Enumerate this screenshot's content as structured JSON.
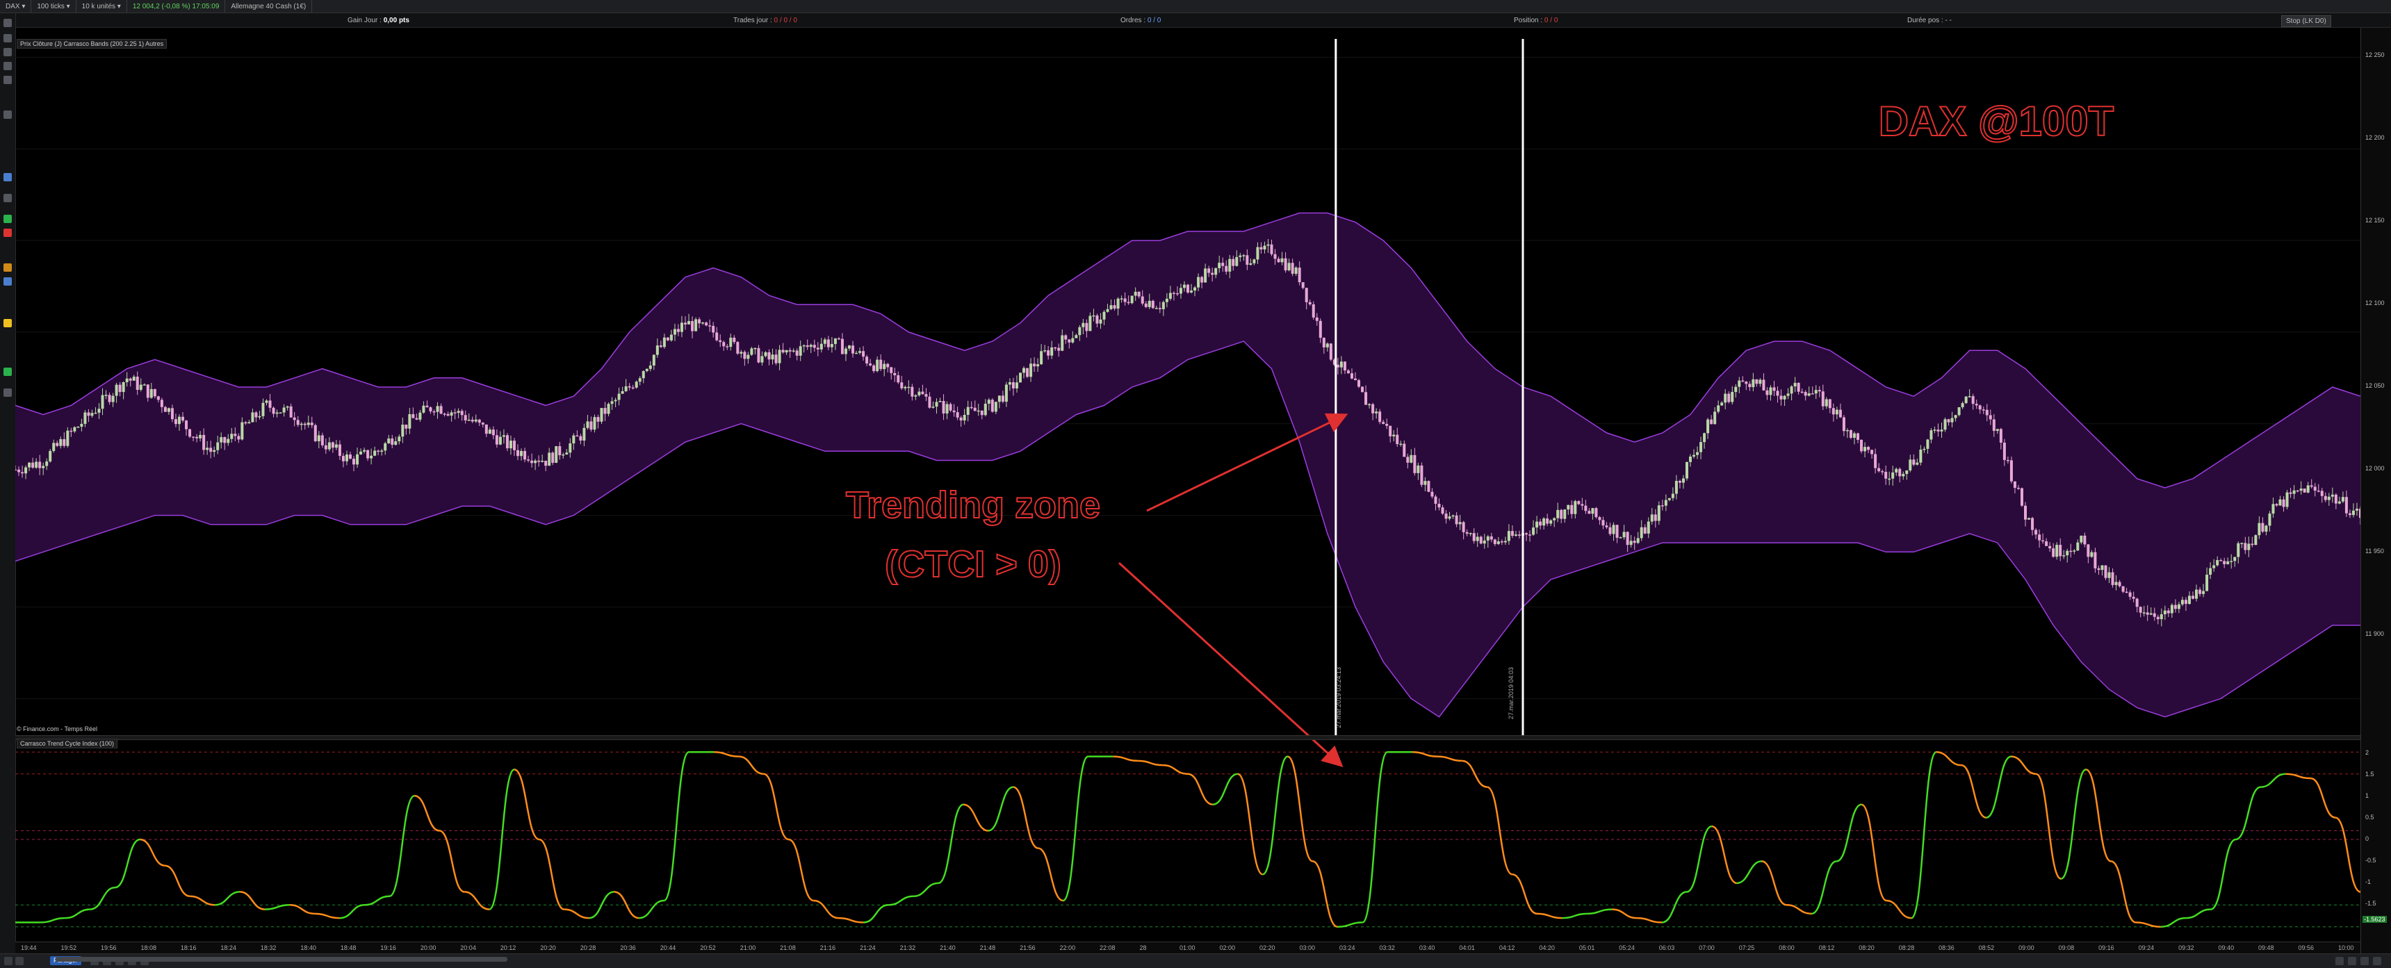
{
  "app": {
    "symbol": "DAX",
    "period": "100 ticks",
    "units": "10 k unités",
    "quote": "12 004,2 (-0,08 %) 17:05:09",
    "instrument": "Allemagne 40 Cash (1€)"
  },
  "infobar": {
    "gain_label": "Gain Jour :",
    "gain_value": "0,00 pts",
    "trades_label": "Trades jour :",
    "trades_value": "0 / 0 / 0",
    "orders_label": "Ordres :",
    "orders_value": "0 / 0",
    "position_label": "Position :",
    "position_value": "0 / 0",
    "duration_label": "Durée pos :",
    "duration_value": "- -",
    "stop_label": "Stop (LK D0)"
  },
  "legend": {
    "price_chart": "Prix  Clôture (J)  Carrasco Bands (200 2.25 1)  Autres",
    "source": "© Finance.com - Temps Réel",
    "indicator": "Carrasco Trend Cycle Index (100)"
  },
  "annotations": {
    "title": "DAX @100T",
    "trend_line1": "Trending zone",
    "trend_line2": "(CTCI > 0)",
    "marker1": "27.mar.2019 03:24:13",
    "marker2": "27.mar.2019 04:03"
  },
  "colors": {
    "band_fill": "#2a0a3a",
    "band_line": "#9b3de0",
    "annotation": "#e03030",
    "ctci_up": "#44dd22",
    "ctci_down": "#ff8c1a",
    "candle_up": "#b9d9a6",
    "candle_down": "#e6a8d5"
  },
  "price_axis": [
    "12 250",
    "12 200",
    "12 150",
    "12 100",
    "12 050",
    "12 000",
    "11 950",
    "11 900"
  ],
  "indicator_axis": [
    "2",
    "1.5",
    "1",
    "0.5",
    "0",
    "-0.5",
    "-1",
    "-1.5"
  ],
  "time_axis": [
    "19:44",
    "19:52",
    "19:56",
    "18:08",
    "18:16",
    "18:24",
    "18:32",
    "18:40",
    "18:48",
    "19:16",
    "20:00",
    "20:04",
    "20:12",
    "20:20",
    "20:28",
    "20:36",
    "20:44",
    "20:52",
    "21:00",
    "21:08",
    "21:16",
    "21:24",
    "21:32",
    "21:40",
    "21:48",
    "21:56",
    "22:00",
    "22:08",
    "28",
    "01:00",
    "02:00",
    "02:20",
    "03:00",
    "03:24",
    "03:32",
    "03:40",
    "04:01",
    "04:12",
    "04:20",
    "05:01",
    "05:24",
    "06:03",
    "07:00",
    "07:25",
    "08:00",
    "08:12",
    "08:20",
    "08:28",
    "08:36",
    "08:52",
    "09:00",
    "09:08",
    "09:16",
    "09:24",
    "09:32",
    "09:40",
    "09:48",
    "09:56",
    "10:00"
  ],
  "ctci_last": "-1.5623",
  "price_last": "12 004",
  "bottom": {
    "share": "Partager"
  },
  "chart_data": [
    {
      "type": "line",
      "name": "price",
      "ylim": [
        11880,
        12260
      ],
      "series": [
        {
          "name": "Clôture",
          "values": [
            12025,
            12030,
            12045,
            12060,
            12075,
            12065,
            12050,
            12035,
            12045,
            12060,
            12055,
            12040,
            12030,
            12035,
            12050,
            12060,
            12055,
            12045,
            12035,
            12030,
            12040,
            12055,
            12070,
            12090,
            12105,
            12100,
            12090,
            12085,
            12090,
            12095,
            12090,
            12080,
            12070,
            12060,
            12055,
            12060,
            12075,
            12090,
            12100,
            12110,
            12120,
            12115,
            12125,
            12135,
            12140,
            12145,
            12130,
            12090,
            12070,
            12050,
            12030,
            12005,
            11990,
            11985,
            11990,
            12000,
            12005,
            11995,
            11985,
            12005,
            12030,
            12060,
            12075,
            12065,
            12070,
            12060,
            12040,
            12020,
            12030,
            12050,
            12065,
            12045,
            12000,
            11980,
            11985,
            11965,
            11950,
            11945,
            11955,
            11975,
            11985,
            12005,
            12015,
            12010,
            12000
          ]
        },
        {
          "name": "Carrasco Bands (upper)",
          "values": [
            12060,
            12055,
            12060,
            12070,
            12080,
            12085,
            12080,
            12075,
            12070,
            12070,
            12075,
            12080,
            12075,
            12070,
            12070,
            12075,
            12075,
            12070,
            12065,
            12060,
            12065,
            12080,
            12100,
            12115,
            12130,
            12135,
            12130,
            12120,
            12115,
            12115,
            12115,
            12110,
            12100,
            12095,
            12090,
            12095,
            12105,
            12120,
            12130,
            12140,
            12150,
            12150,
            12155,
            12155,
            12155,
            12160,
            12165,
            12165,
            12160,
            12150,
            12135,
            12115,
            12095,
            12080,
            12070,
            12065,
            12055,
            12045,
            12040,
            12045,
            12055,
            12075,
            12090,
            12095,
            12095,
            12090,
            12080,
            12070,
            12065,
            12075,
            12090,
            12090,
            12080,
            12065,
            12050,
            12035,
            12020,
            12015,
            12020,
            12030,
            12040,
            12050,
            12060,
            12070,
            12065
          ]
        },
        {
          "name": "Carrasco Bands (lower)",
          "values": [
            11975,
            11980,
            11985,
            11990,
            11995,
            12000,
            12000,
            11995,
            11995,
            11995,
            12000,
            12000,
            11995,
            11995,
            11995,
            12000,
            12005,
            12005,
            12000,
            11995,
            12000,
            12010,
            12020,
            12030,
            12040,
            12045,
            12050,
            12045,
            12040,
            12035,
            12035,
            12035,
            12035,
            12030,
            12030,
            12030,
            12035,
            12045,
            12055,
            12060,
            12070,
            12075,
            12085,
            12090,
            12095,
            12080,
            12040,
            11990,
            11950,
            11920,
            11900,
            11890,
            11910,
            11930,
            11950,
            11965,
            11970,
            11975,
            11980,
            11985,
            11985,
            11985,
            11985,
            11985,
            11985,
            11985,
            11985,
            11980,
            11980,
            11985,
            11990,
            11985,
            11965,
            11940,
            11920,
            11905,
            11895,
            11890,
            11895,
            11900,
            11910,
            11920,
            11930,
            11940,
            11940
          ]
        }
      ]
    },
    {
      "type": "line",
      "name": "Carrasco Trend Cycle Index (100)",
      "ylim": [
        -2.1,
        2.1
      ],
      "series": [
        {
          "name": "CTCI",
          "values": [
            -1.9,
            -1.9,
            -1.8,
            -1.6,
            -1.1,
            0.0,
            -0.6,
            -1.3,
            -1.5,
            -1.2,
            -1.6,
            -1.5,
            -1.7,
            -1.8,
            -1.5,
            -1.3,
            1.0,
            0.2,
            -1.2,
            -1.6,
            1.6,
            0.0,
            -1.6,
            -1.8,
            -1.2,
            -1.8,
            -1.4,
            2.0,
            2.0,
            1.9,
            1.5,
            0.0,
            -1.4,
            -1.8,
            -1.9,
            -1.5,
            -1.3,
            -1.0,
            0.8,
            0.2,
            1.2,
            -0.2,
            -1.4,
            1.9,
            1.9,
            1.8,
            1.7,
            1.5,
            0.8,
            1.5,
            -0.8,
            1.9,
            -0.5,
            -2.0,
            -1.9,
            2.0,
            2.0,
            1.9,
            1.8,
            1.2,
            -0.8,
            -1.7,
            -1.8,
            -1.7,
            -1.6,
            -1.8,
            -1.9,
            -1.2,
            0.3,
            -1.0,
            -0.5,
            -1.5,
            -1.7,
            -0.5,
            0.8,
            -1.4,
            -1.8,
            2.0,
            1.7,
            0.5,
            1.9,
            1.5,
            -0.9,
            1.6,
            -0.5,
            -1.9,
            -2.0,
            -1.8,
            -1.6,
            0.0,
            1.2,
            1.5,
            1.4,
            0.5,
            -1.2
          ]
        }
      ]
    }
  ]
}
